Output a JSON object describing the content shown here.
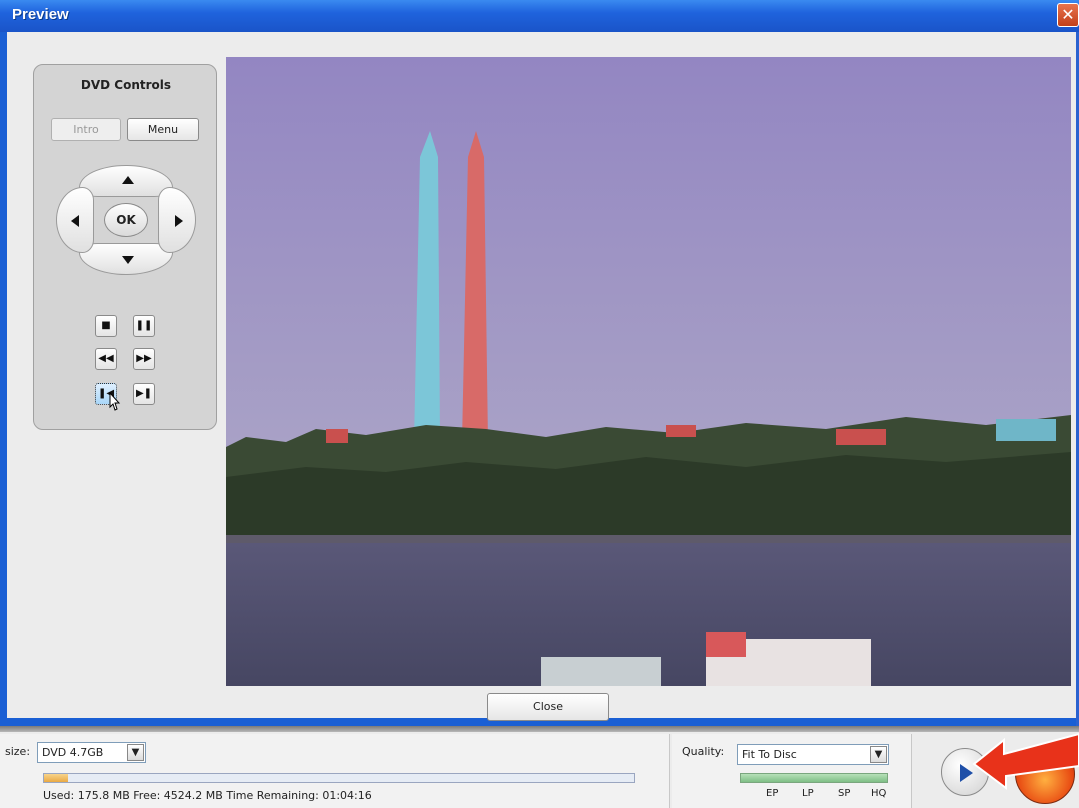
{
  "window": {
    "title": "Preview",
    "close_glyph": "✕"
  },
  "dvd_controls": {
    "title": "DVD Controls",
    "intro_label": "Intro",
    "menu_label": "Menu",
    "ok_label": "OK",
    "stop_glyph": "■",
    "pause_glyph": "❚❚",
    "rewind_glyph": "◀◀",
    "fast_forward_glyph": "▶▶",
    "previous_chapter_glyph": "❚◀",
    "next_chapter_glyph": "▶❚"
  },
  "dialog": {
    "close_label": "Close"
  },
  "bottom_bar": {
    "size_label": "size:",
    "size_value": "DVD 4.7GB",
    "dropdown_glyph": "▼",
    "usage_fraction": 0.04,
    "usage_text": "Used: 175.8 MB  Free: 4524.2 MB  Time Remaining: 01:04:16",
    "quality_label": "Quality:",
    "quality_value": "Fit To Disc",
    "quality_marks": [
      "EP",
      "LP",
      "SP",
      "HQ"
    ]
  },
  "colors": {
    "titlebar": "#1f63dd",
    "accent_arrow": "#e8321a"
  }
}
